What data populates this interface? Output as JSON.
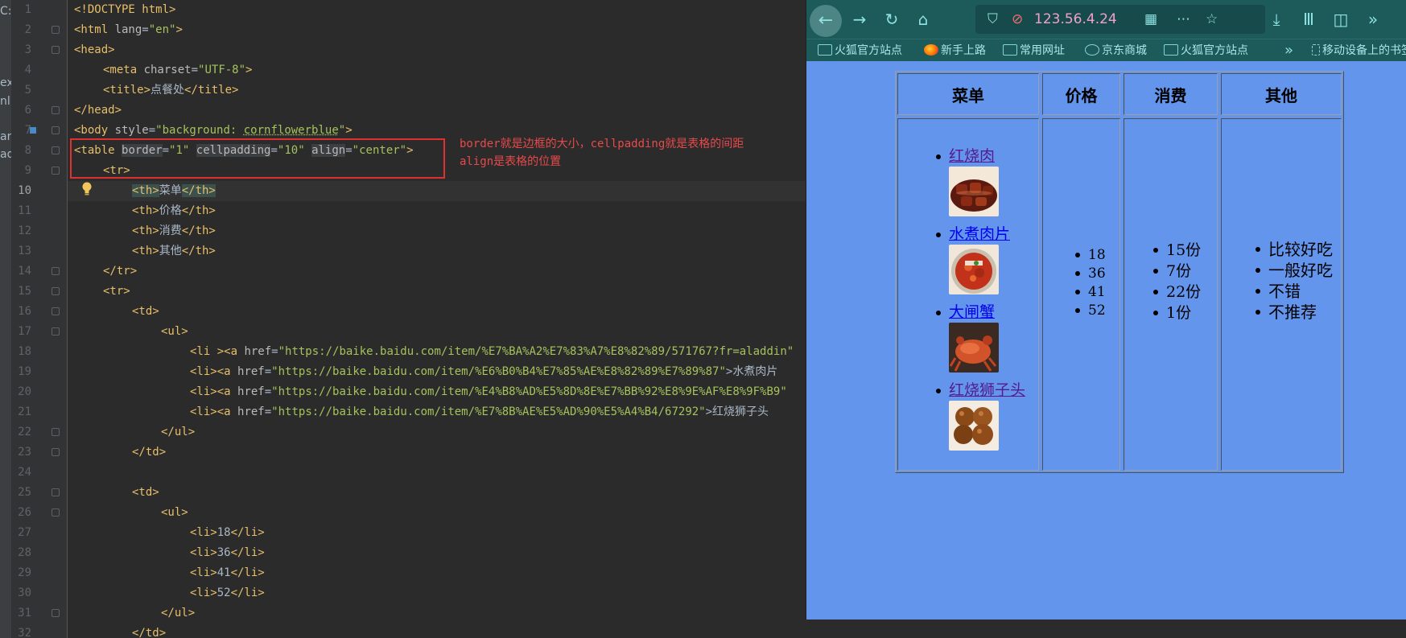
{
  "editor": {
    "side_labels": [
      "C:",
      "ex",
      "nl",
      "ar",
      "ad"
    ],
    "line_numbers": [
      "1",
      "2",
      "3",
      "4",
      "5",
      "6",
      "7",
      "8",
      "9",
      "10",
      "11",
      "12",
      "13",
      "14",
      "15",
      "16",
      "17",
      "18",
      "19",
      "20",
      "21",
      "22",
      "23",
      "24",
      "25",
      "26",
      "27",
      "28",
      "29",
      "30",
      "31",
      "32"
    ],
    "lines": {
      "l1": "<!DOCTYPE html>",
      "l2a": "<html ",
      "l2b": "lang",
      "l2c": "=",
      "l2d": "\"en\"",
      "l2e": ">",
      "l3": "<head>",
      "l4a": "<meta ",
      "l4b": "charset",
      "l4c": "=",
      "l4d": "\"UTF-8\"",
      "l4e": ">",
      "l5a": "<title>",
      "l5b": "点餐处",
      "l5c": "</title>",
      "l6": "</head>",
      "l7a": "<body ",
      "l7b": "style",
      "l7c": "=",
      "l7d": "\"background: ",
      "l7e": "cornflowerblue",
      "l7f": "\"",
      "l7g": ">",
      "l8a": "<table ",
      "l8b": "border",
      "l8c": "=",
      "l8d": "\"1\"",
      "l8e": " ",
      "l8f": "cellpadding",
      "l8g": "=",
      "l8h": "\"10\"",
      "l8i": " ",
      "l8j": "align",
      "l8k": "=",
      "l8l": "\"center\"",
      "l8m": ">",
      "l9": "<tr>",
      "l10a": "<th>",
      "l10b": "菜单",
      "l10c": "</th>",
      "l11a": "<th>",
      "l11b": "价格",
      "l11c": "</th>",
      "l12a": "<th>",
      "l12b": "消费",
      "l12c": "</th>",
      "l13a": "<th>",
      "l13b": "其他",
      "l13c": "</th>",
      "l14": "</tr>",
      "l15": "<tr>",
      "l16": "<td>",
      "l17": "<ul>",
      "l18a": "<li ><a ",
      "l18b": "href",
      "l18c": "=",
      "l18d": "\"https://baike.baidu.com/item/%E7%BA%A2%E7%83%A7%E8%82%89/571767?fr=aladdin\"",
      "l19a": "<li><a ",
      "l19b": "href",
      "l19c": "=",
      "l19d": "\"https://baike.baidu.com/item/%E6%B0%B4%E7%85%AE%E8%82%89%E7%89%87\"",
      "l19e": ">水煮肉片",
      "l20a": "<li><a ",
      "l20b": "href",
      "l20c": "=",
      "l20d": "\"https://baike.baidu.com/item/%E4%B8%AD%E5%8D%8E%E7%BB%92%E8%9E%AF%E8%9F%B9\"",
      "l21a": "<li><a ",
      "l21b": "href",
      "l21c": "=",
      "l21d": "\"https://baike.baidu.com/item/%E7%8B%AE%E5%AD%90%E5%A4%B4/67292\"",
      "l21e": ">红烧狮子头",
      "l22": "</ul>",
      "l23": "</td>",
      "l25": "<td>",
      "l26": "<ul>",
      "l27a": "<li>",
      "l27b": "18",
      "l27c": "</li>",
      "l28a": "<li>",
      "l28b": "36",
      "l28c": "</li>",
      "l29a": "<li>",
      "l29b": "41",
      "l29c": "</li>",
      "l30a": "<li>",
      "l30b": "52",
      "l30c": "</li>",
      "l31": "</ul>",
      "l32": "</td>"
    },
    "annotation": "border就是边框的大小，cellpadding就是表格的间距\nalign是表格的位置"
  },
  "browser": {
    "url": "123.56.4.24",
    "toolbar_icons": [
      "back-icon",
      "forward-icon",
      "reload-icon",
      "home-icon",
      "shield-icon",
      "insecure-lock-icon",
      "qr-icon",
      "more-icon",
      "star-icon",
      "download-icon",
      "library-icon",
      "sidebar-icon",
      "overflow-icon"
    ],
    "bookmarks": [
      "火狐官方站点",
      "新手上路",
      "常用网址",
      "京东商城",
      "火狐官方站点",
      "移动设备上的书签"
    ],
    "page": {
      "headers": [
        "菜单",
        "价格",
        "消费",
        "其他"
      ],
      "menu_items": [
        "红烧肉",
        "水煮肉片",
        "大闸蟹",
        "红烧狮子头"
      ],
      "prices": [
        "18",
        "36",
        "41",
        "52"
      ],
      "consumption": [
        "15份",
        "7份",
        "22份",
        "1份"
      ],
      "other": [
        "比较好吃",
        "一般好吃",
        "不错",
        "不推荐"
      ]
    },
    "colors": {
      "page_bg": "#6495ed",
      "toolbar_bg": "#1d5a5a",
      "link": "#0000ee",
      "visited_link": "#551a8b"
    }
  }
}
